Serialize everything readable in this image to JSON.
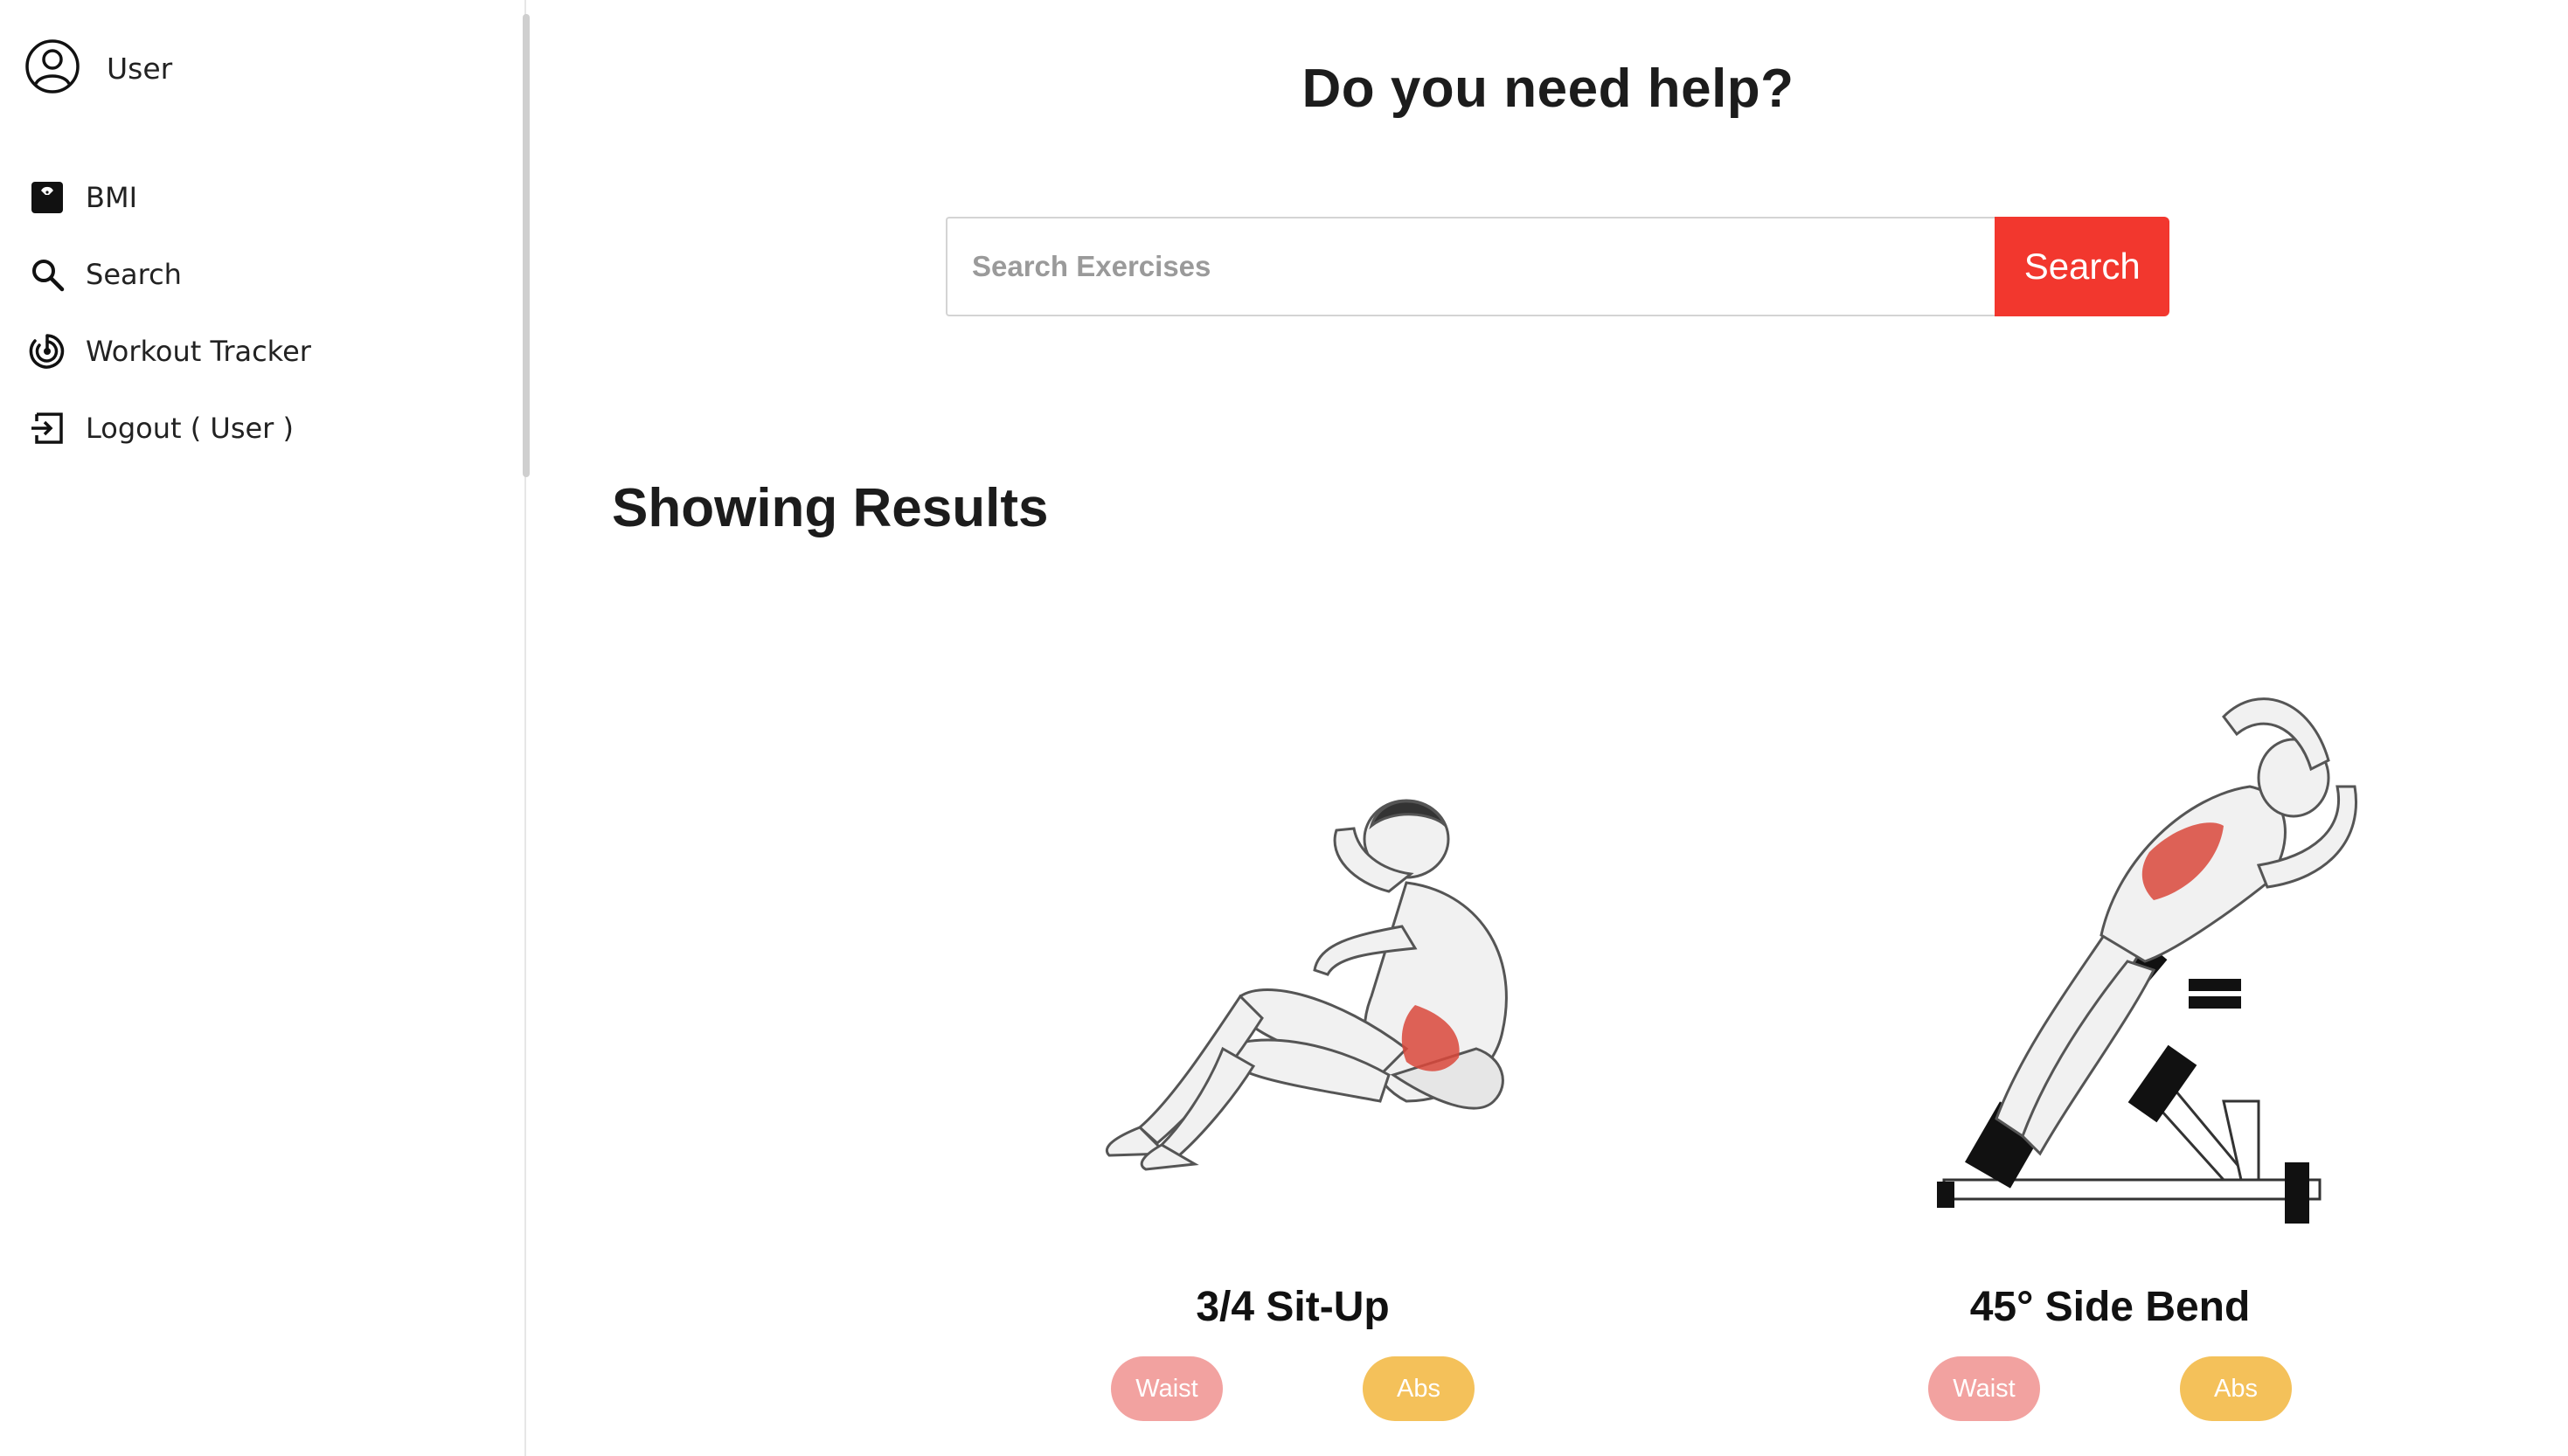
{
  "sidebar": {
    "user_label": "User",
    "items": [
      {
        "label": "BMI",
        "icon": "scale-icon"
      },
      {
        "label": "Search",
        "icon": "search-icon"
      },
      {
        "label": "Workout Tracker",
        "icon": "tracker-icon"
      },
      {
        "label": "Logout ( User )",
        "icon": "logout-icon"
      }
    ]
  },
  "main": {
    "help_title": "Do you need help?",
    "search": {
      "placeholder": "Search Exercises",
      "value": "",
      "button_label": "Search"
    },
    "results_title": "Showing Results",
    "exercises": [
      {
        "name": "3/4 Sit-Up",
        "tags": [
          "Waist",
          "Abs"
        ]
      },
      {
        "name": "45° Side Bend",
        "tags": [
          "Waist",
          "Abs"
        ]
      }
    ]
  },
  "colors": {
    "accent": "#f2372e",
    "tag_waist": "#f2a2a0",
    "tag_abs": "#f4c15a",
    "muscle_highlight": "#d9483b"
  }
}
